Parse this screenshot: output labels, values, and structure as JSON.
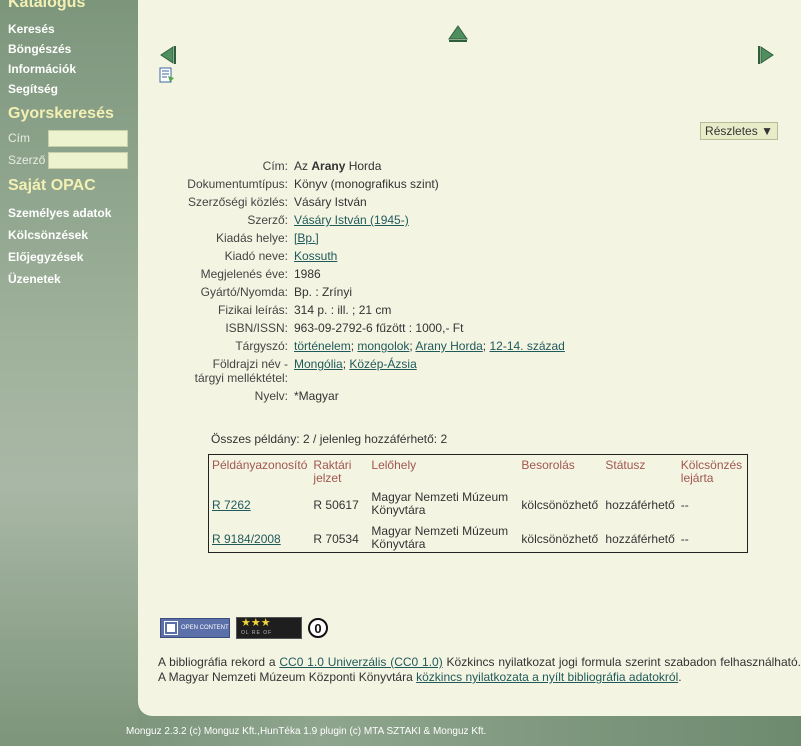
{
  "sidebar": {
    "catalog_title": "Katalógus",
    "nav": [
      "Keresés",
      "Böngészés",
      "Információk",
      "Segítség"
    ],
    "quicksearch_title": "Gyorskeresés",
    "qs_title_label": "Cím",
    "qs_author_label": "Szerző",
    "opac_title": "Saját OPAC",
    "opac_nav": [
      "Személyes adatok",
      "Kölcsönzések",
      "Előjegyzések",
      "Üzenetek"
    ]
  },
  "toolbar": {
    "details_label": "Részletes ▼"
  },
  "record": {
    "cim_label": "Cím:",
    "cim_pre": "Az",
    "cim_bold": "Arany",
    "cim_post": "Horda",
    "doctype_label": "Dokumentumtípus:",
    "doctype": "Könyv (monografikus szint)",
    "authorship_label": "Szerzőségi közlés:",
    "authorship": "Vásáry István",
    "author_label": "Szerző:",
    "author": "Vásáry István (1945-)",
    "place_label": "Kiadás helye:",
    "place": "[Bp.]",
    "publisher_label": "Kiadó neve:",
    "publisher": "Kossuth",
    "year_label": "Megjelenés éve:",
    "year": "1986",
    "printer_label": "Gyártó/Nyomda:",
    "printer": "Bp. : Zrínyi",
    "physical_label": "Fizikai leírás:",
    "physical": "314 p. : ill. ; 21 cm",
    "isbn_label": "ISBN/ISSN:",
    "isbn": "963-09-2792-6 fűzött : 1000,- Ft",
    "subject_label": "Tárgyszó:",
    "subjects": [
      "történelem",
      "mongolok",
      "Arany Horda",
      "12-14. század"
    ],
    "geo_label": "Földrajzi név - tárgyi melléktétel:",
    "geo": [
      "Mongólia",
      "Közép-Ázsia"
    ],
    "language_label": "Nyelv:",
    "language": "*Magyar"
  },
  "copies_summary": "Összes példány: 2 / jelenleg hozzáférhető: 2",
  "copies": {
    "headers": [
      "Példányazonosító",
      "Raktári jelzet",
      "Lelőhely",
      "Besorolás",
      "Státusz",
      "Kölcsönzés lejárta"
    ],
    "rows": [
      [
        "R 7262",
        "R 50617",
        "Magyar Nemzeti Múzeum Könyvtára",
        "kölcsönözhető",
        "hozzáférhető",
        "--"
      ],
      [
        "R 9184/2008",
        "R 70534",
        "Magyar Nemzeti Múzeum Könyvtára",
        "kölcsönözhető",
        "hozzáférhető",
        "--"
      ]
    ]
  },
  "badges": {
    "open_content": "OPEN CONTENT",
    "stars": "★★★",
    "stars_sub": "OL RE OF",
    "zero": "0"
  },
  "license": {
    "part1": "A bibliográfia rekord a",
    "link1": "CC0 1.0 Univerzális (CC0 1.0)",
    "part2": "Közkincs nyilatkozat jogi formula szerint szabadon felhasználható. A Magyar Nemzeti Múzeum Központi Könyvtára",
    "link2": "közkincs nyilatkozata a nyílt bibliográfia adatokról",
    "part3": "."
  },
  "footer": "Monguz 2.3.2 (c) Monguz Kft.,HunTéka 1.9 plugin (c) MTA SZTAKI & Monguz Kft."
}
